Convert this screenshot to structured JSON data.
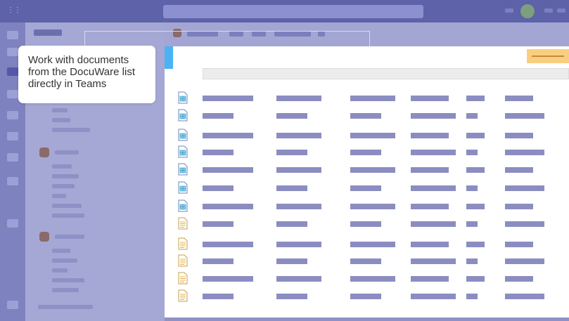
{
  "callout": {
    "text": "Work with documents\nfrom the DocuWare list\ndirectly in Teams"
  },
  "colors": {
    "teams_top": "#5e62a8",
    "overlay": "#8f92c4",
    "accent_blue": "#4ab3f4",
    "accent_orange": "#f9cf7f",
    "placeholder_bar": "#8b8dc1"
  },
  "icons": {
    "table_doc": "spreadsheet-document-icon",
    "text_doc": "text-document-icon"
  },
  "list": {
    "rows": [
      {
        "icon": "table"
      },
      {
        "icon": "table"
      },
      {
        "icon": "table"
      },
      {
        "icon": "table"
      },
      {
        "icon": "table"
      },
      {
        "icon": "table"
      },
      {
        "icon": "table"
      },
      {
        "icon": "text"
      },
      {
        "icon": "text"
      },
      {
        "icon": "text"
      },
      {
        "icon": "text"
      },
      {
        "icon": "text"
      }
    ]
  }
}
